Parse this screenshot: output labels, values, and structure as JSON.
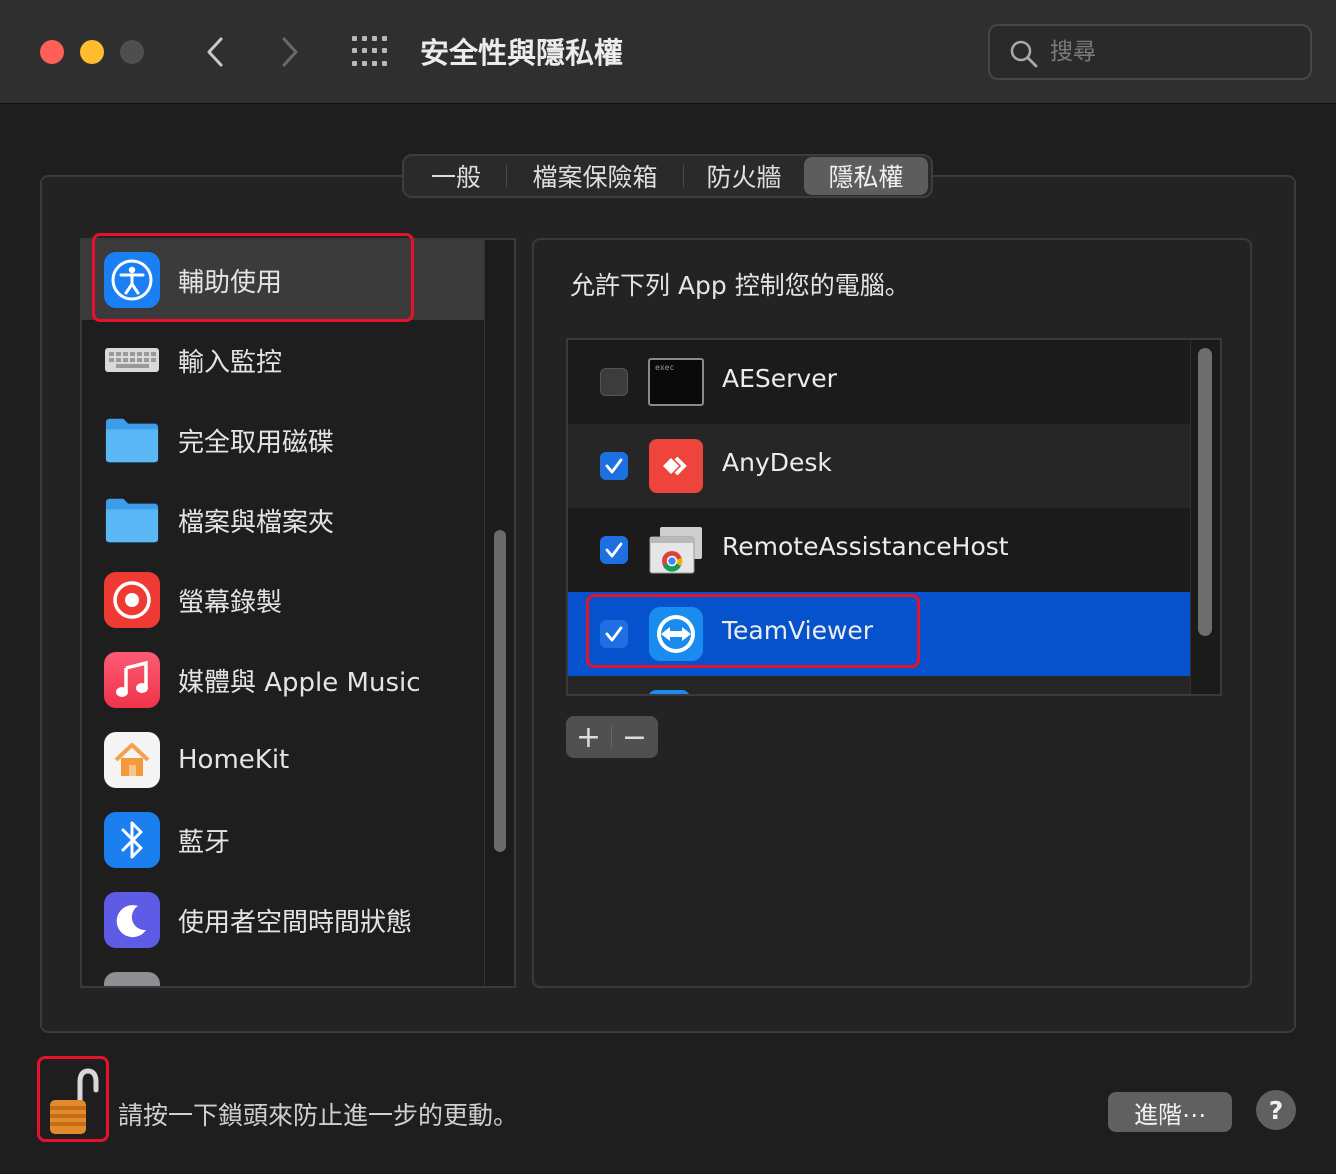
{
  "window": {
    "title": "安全性與隱私權"
  },
  "search": {
    "placeholder": "搜尋"
  },
  "tabs": [
    {
      "label": "一般"
    },
    {
      "label": "檔案保險箱"
    },
    {
      "label": "防火牆"
    },
    {
      "label": "隱私權",
      "selected": true
    }
  ],
  "sidebar": {
    "items": [
      {
        "label": "輔助使用",
        "icon": "accessibility-icon",
        "selected": true
      },
      {
        "label": "輸入監控",
        "icon": "keyboard-icon"
      },
      {
        "label": "完全取用磁碟",
        "icon": "folder-icon"
      },
      {
        "label": "檔案與檔案夾",
        "icon": "folder-icon"
      },
      {
        "label": "螢幕錄製",
        "icon": "screen-record-icon"
      },
      {
        "label": "媒體與 Apple Music",
        "icon": "music-icon"
      },
      {
        "label": "HomeKit",
        "icon": "home-icon"
      },
      {
        "label": "藍牙",
        "icon": "bluetooth-icon"
      },
      {
        "label": "使用者空間時間狀態",
        "icon": "moon-icon"
      }
    ]
  },
  "panel": {
    "description": "允許下列 App 控制您的電腦。",
    "apps": [
      {
        "name": "AEServer",
        "checked": false,
        "icon": "exec-icon"
      },
      {
        "name": "AnyDesk",
        "checked": true,
        "icon": "anydesk-icon"
      },
      {
        "name": "RemoteAssistanceHost",
        "checked": true,
        "icon": "chrome-remote-icon"
      },
      {
        "name": "TeamViewer",
        "checked": true,
        "icon": "teamviewer-icon",
        "selected": true
      }
    ],
    "add_label": "+",
    "remove_label": "−"
  },
  "exec_icon_text": "exec",
  "footer": {
    "lock_text": "請按一下鎖頭來防止進一步的更動。",
    "advanced_label": "進階⋯",
    "help_label": "?"
  },
  "colors": {
    "highlight": "#e8112d",
    "selection": "#0652cc",
    "checkbox_on": "#1e6fe0"
  }
}
